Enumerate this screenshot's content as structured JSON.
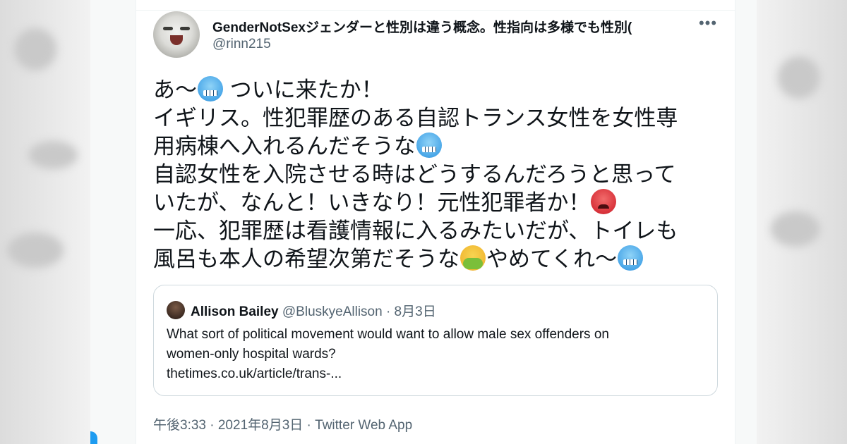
{
  "author": {
    "display_name": "GenderNotSexジェンダーと性別は違う概念。性指向は多様でも性別(",
    "handle": "@rinn215"
  },
  "tweet": {
    "line1_a": "あ〜",
    "line1_b": "ついに来たか！",
    "line2": "イギリス。性犯罪歴のある自認トランス女性を女性専",
    "line3": "用病棟へ入れるんだそうな",
    "line4": "自認女性を入院させる時はどうするんだろうと思って",
    "line5": "いたが、なんと！いきなり！元性犯罪者か！",
    "line6": "一応、犯罪歴は看護情報に入るみたいだが、トイレも",
    "line7_a": "風呂も本人の希望次第だそうな",
    "line7_b": "やめてくれ〜",
    "emojis": {
      "cold": "cold-face-emoji",
      "angry": "angry-face-emoji",
      "sick": "vomiting-face-emoji"
    }
  },
  "quoted_tweet": {
    "name": "Allison Bailey",
    "meta": "@BluskyeAllison · 8月3日",
    "text_line1": "What sort of political movement would want to allow male sex offenders on",
    "text_line2": "women-only hospital wards?",
    "link": "thetimes.co.uk/article/trans-..."
  },
  "footer": {
    "meta": "午後3:33 · 2021年8月3日 · Twitter Web App"
  },
  "colors": {
    "text_primary": "#0f1419",
    "text_secondary": "#536471",
    "border": "#cfd9de",
    "accent": "#1d9bf0"
  }
}
